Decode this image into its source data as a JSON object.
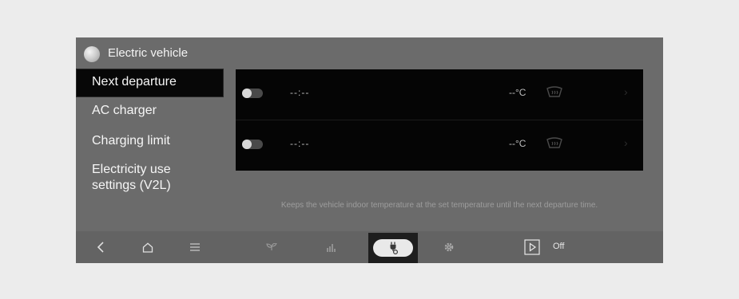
{
  "header": {
    "title": "Electric vehicle",
    "icon": "globe-icon"
  },
  "sidebar": {
    "items": [
      {
        "label": "Next departure",
        "active": true
      },
      {
        "label": "AC charger",
        "active": false
      },
      {
        "label": "Charging limit",
        "active": false
      },
      {
        "label": "Electricity use settings (V2L)",
        "line1": "Electricity use",
        "line2": "settings (V2L)",
        "active": false
      }
    ]
  },
  "departures": [
    {
      "time": "--:--",
      "temperature": "--°C",
      "enabled": false
    },
    {
      "time": "--:--",
      "temperature": "--°C",
      "enabled": false
    }
  ],
  "hint": "Keeps the vehicle indoor temperature at the set temperature until the next departure time.",
  "bottom_bar": {
    "icons": [
      "back-icon",
      "home-icon",
      "menu-icon",
      "eco-icon",
      "energy-chart-icon",
      "charging-plug-icon",
      "settings-gear-icon",
      "play-icon"
    ],
    "selected": "charging-plug-icon",
    "media_status": "Off"
  }
}
